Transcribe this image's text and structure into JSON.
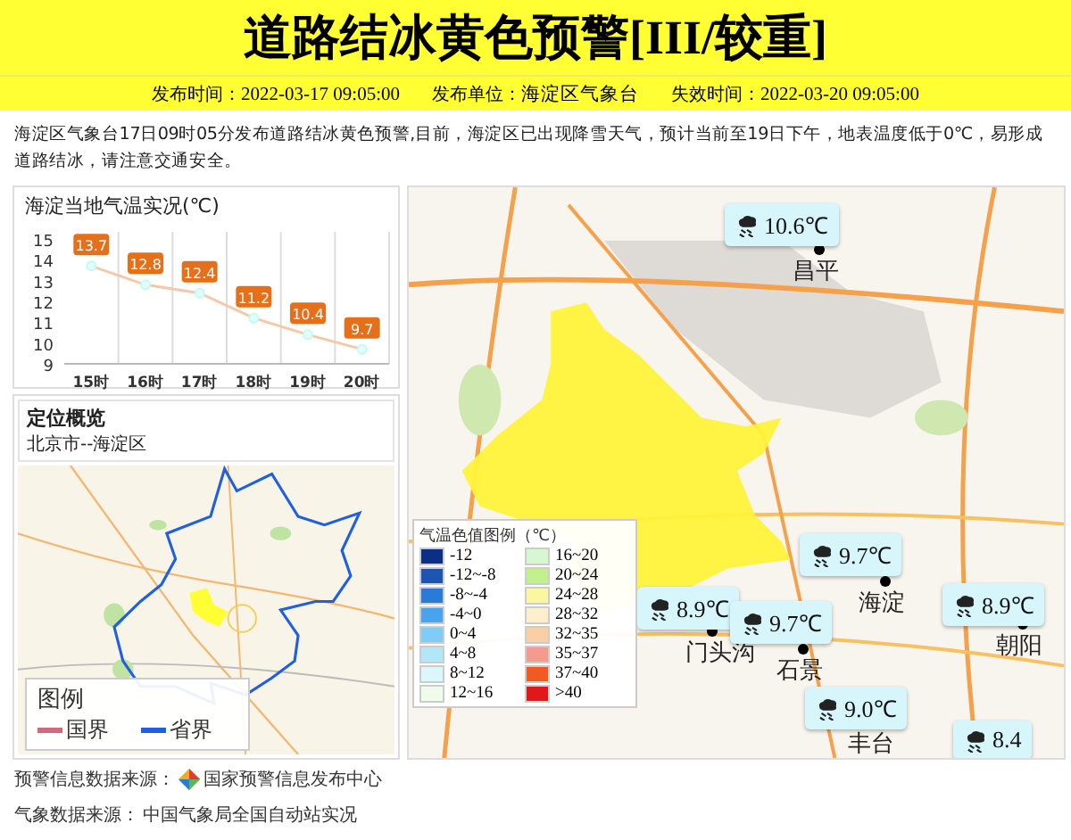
{
  "header": {
    "title": "道路结冰黄色预警[III/较重]"
  },
  "meta": [
    {
      "label": "发布时间：",
      "value": "2022-03-17 09:05:00"
    },
    {
      "label": "发布单位：",
      "value": "海淀区气象台"
    },
    {
      "label": "失效时间：",
      "value": "2022-03-20 09:05:00"
    }
  ],
  "description": "海淀区气象台17日09时05分发布道路结冰黄色预警,目前，海淀区已出现降雪天气，预计当前至19日下午，地表温度低于0℃，易形成道路结冰，请注意交通安全。",
  "temperature_panel": {
    "title": "海淀当地气温实况(℃)",
    "chart_data": {
      "type": "line",
      "categories": [
        "15时",
        "16时",
        "17时",
        "18时",
        "19时",
        "20时"
      ],
      "series": [
        {
          "color": "#f5c9a8",
          "marker": true,
          "values": [
            13.7,
            12.8,
            12.4,
            11.2,
            10.4,
            9.7
          ]
        }
      ],
      "ylim": [
        9,
        15
      ],
      "yticks": [
        9,
        10,
        11,
        12,
        13,
        14,
        15
      ],
      "data_labels": true
    }
  },
  "location_panel": {
    "title": "定位概览",
    "subtitle": "北京市--海淀区",
    "legend": {
      "title": "图例",
      "items": [
        {
          "label": "国界",
          "color": "#d0687e"
        },
        {
          "label": "省界",
          "color": "#1f5fe0"
        }
      ]
    }
  },
  "map": {
    "legend": {
      "title": "气温色值图例（℃）",
      "items": [
        {
          "label": "-12",
          "color": "#0b2f86"
        },
        {
          "label": "16~20",
          "color": "#d6f7d2"
        },
        {
          "label": "-12~-8",
          "color": "#1e55b0"
        },
        {
          "label": "20~24",
          "color": "#c2f08a"
        },
        {
          "label": "-8~-4",
          "color": "#2a7ad8"
        },
        {
          "label": "24~28",
          "color": "#fbf7a0"
        },
        {
          "label": "-4~0",
          "color": "#4aa3ee"
        },
        {
          "label": "28~32",
          "color": "#fdefcc"
        },
        {
          "label": "0~4",
          "color": "#7fcdf7"
        },
        {
          "label": "32~35",
          "color": "#fbcfa6"
        },
        {
          "label": "4~8",
          "color": "#b3e6f7"
        },
        {
          "label": "35~37",
          "color": "#f59a8c"
        },
        {
          "label": "8~12",
          "color": "#dcf7fa"
        },
        {
          "label": "37~40",
          "color": "#f25a22"
        },
        {
          "label": "12~16",
          "color": "#f0fbea"
        },
        {
          "label": ">40",
          "color": "#e01818"
        }
      ]
    },
    "places": [
      "昌平",
      "海淀",
      "门头沟",
      "石景",
      "丰台",
      "朝阳"
    ],
    "stations": [
      "10.6℃",
      "9.7℃",
      "8.9℃",
      "9.7℃",
      "9.0℃",
      "8.9℃",
      "8.4"
    ]
  },
  "footer": [
    {
      "label": "预警信息数据来源：",
      "value": "国家预警信息发布中心",
      "logo": true
    },
    {
      "label": "气象数据来源：",
      "value": "中国气象局全国自动站实况",
      "logo": false
    }
  ]
}
